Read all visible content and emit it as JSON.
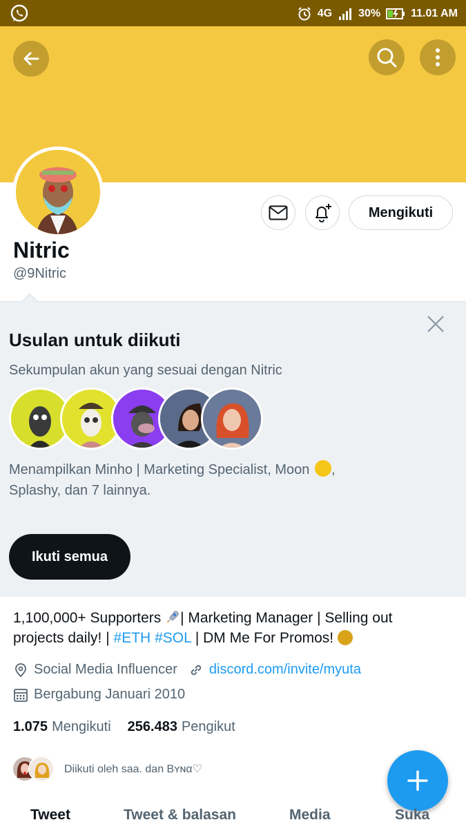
{
  "colors": {
    "banner": "#f5c842",
    "statusbar": "#7a5a00",
    "link": "#1d9bf0",
    "fab": "#1d9bf0"
  },
  "statusbar": {
    "network": "4G",
    "battery": "30%",
    "time": "11.01 AM"
  },
  "profile": {
    "name": "Nitric",
    "handle": "@9Nitric",
    "follow_label": "Mengikuti"
  },
  "suggestions": {
    "title": "Usulan untuk diikuti",
    "subtitle": "Sekumpulan akun yang sesuai dengan Nitric",
    "desc_part1": "Menampilkan Minho | Marketing Specialist, Moon",
    "desc_part2": ",",
    "desc_part3": "Splashy, dan 7 lainnya.",
    "follow_all_label": "Ikuti semua"
  },
  "bio": {
    "part1": "1,100,000+ Supporters",
    "part2": "| Marketing Manager | Selling out projects daily! |",
    "tag1": "#ETH",
    "tag2": "#SOL",
    "part3": "| DM Me For Promos!"
  },
  "meta": {
    "location": "Social Media Influencer",
    "link": "discord.com/invite/myuta",
    "joined": "Bergabung Januari 2010"
  },
  "counts": {
    "following_num": "1.075",
    "following_label": "Mengikuti",
    "followers_num": "256.483",
    "followers_label": "Pengikut"
  },
  "followed_by": "Diikuti oleh saa. dan Bʏɴα♡",
  "tabs": [
    "Tweet",
    "Tweet & balasan",
    "Media",
    "Suka"
  ]
}
